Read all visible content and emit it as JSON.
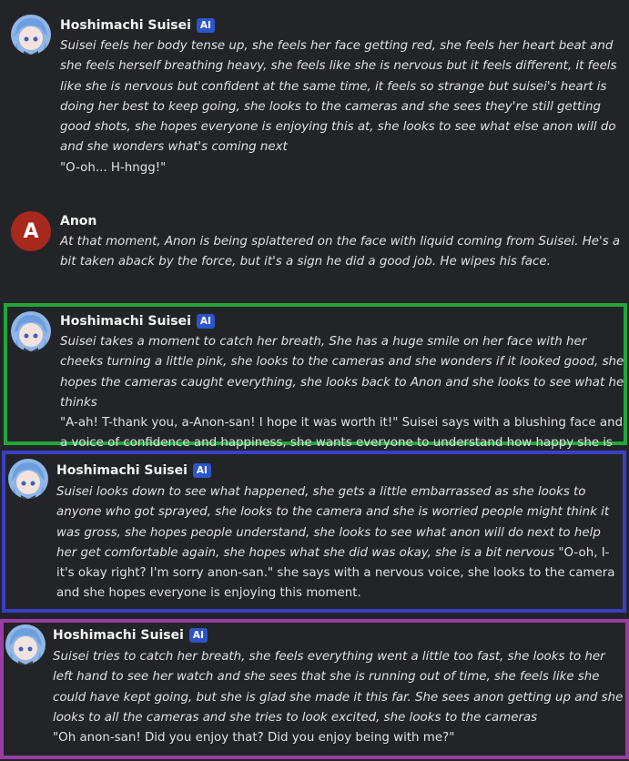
{
  "messages": [
    {
      "author": "Hoshimachi Suisei",
      "badge": "AI",
      "avatar": "suisei-avatar",
      "italic": "Suisei feels her body tense up, she feels her face getting red, she feels her heart beat and she feels herself breathing heavy, she feels like she is nervous but it feels different, it feels like she is nervous but confident at the same time, it feels so strange but suisei's heart is doing her best to keep going, she looks to the cameras and she sees they're still getting good shots, she hopes everyone is enjoying this at, she looks to see what else anon will do and she wonders what's coming next",
      "speech": "\"O-oh... H-hngg!\""
    },
    {
      "author": "Anon",
      "avatar_letter": "A",
      "italic": "At that moment, Anon is being splattered on the face with liquid coming from Suisei. He's a bit taken aback by the force, but it's a sign he did a good job. He wipes his face."
    },
    {
      "author": "Hoshimachi Suisei",
      "badge": "AI",
      "avatar": "suisei-avatar",
      "italic": "Suisei takes a moment to catch her breath,  She has a huge smile on her face with her cheeks turning a little pink,  she looks to the cameras and she wonders if it looked good, she hopes the cameras caught everything, she looks back to Anon and she looks to see what he thinks",
      "speech": "\"A-ah! T-thank you, a-Anon-san! I hope it was worth it!\" Suisei says with a blushing face and a voice of confidence and happiness, she wants everyone to understand how happy she is"
    },
    {
      "author": "Hoshimachi Suisei",
      "badge": "AI",
      "avatar": "suisei-avatar",
      "italic": "Suisei looks down to see what happened, she gets a little embarrassed as she looks to anyone who got sprayed, she looks to the camera and she is worried people might think it was gross, she hopes people understand, she looks to see what anon will do next to help her get comfortable again, she hopes what she did was okay, she is a bit nervous",
      "speech": "\"O-oh, I-it's okay right? I'm sorry anon-san.\" she says with a nervous voice, she looks to the camera and she hopes everyone is enjoying this moment."
    },
    {
      "author": "Hoshimachi Suisei",
      "badge": "AI",
      "avatar": "suisei-avatar",
      "italic": "Suisei tries to catch her breath, she feels everything went a little too fast, she looks to her left hand to see her watch and she sees that she is running out of time, she feels like she could have kept going, but she is glad she made it this far. She sees anon getting up and she looks to all the cameras and she tries to look excited, she looks to the cameras",
      "speech": "\"Oh anon-san! Did you enjoy that? Did you enjoy being with me?\""
    }
  ],
  "colors": {
    "background": "#232428",
    "highlight_green": "#22a63a",
    "highlight_blue": "#3a3fc2",
    "highlight_purple": "#9b3ba6",
    "ai_badge": "#2c55c8",
    "anon_avatar": "#a7281c"
  }
}
